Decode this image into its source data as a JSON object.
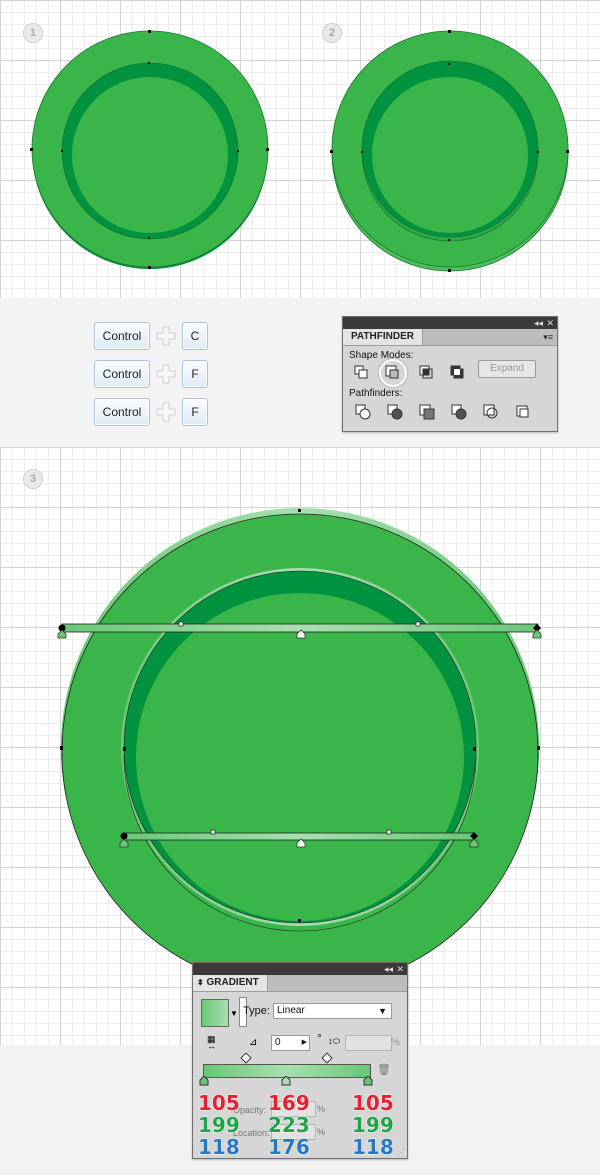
{
  "steps": [
    "1",
    "2",
    "3"
  ],
  "shortcuts": [
    {
      "modifier": "Control",
      "key": "C"
    },
    {
      "modifier": "Control",
      "key": "F"
    },
    {
      "modifier": "Control",
      "key": "F"
    }
  ],
  "pathfinder": {
    "title": "PATHFINDER",
    "shape_modes_label": "Shape Modes:",
    "pathfinders_label": "Pathfinders:",
    "expand_label": "Expand",
    "collapse_glyph": "◂◂",
    "close_glyph": "✕",
    "menu_glyph": "▾≡"
  },
  "gradient": {
    "title": "GRADIENT",
    "type_label": "Type:",
    "type_value": "Linear",
    "angle_value": "0",
    "degree_symbol": "°",
    "percent_symbol": "%",
    "opacity_label": "Opacity:",
    "location_label": "Location:",
    "collapse_glyph": "◂◂",
    "close_glyph": "✕",
    "stops": [
      {
        "r": "105",
        "g": "199",
        "b": "118"
      },
      {
        "r": "169",
        "g": "223",
        "b": "176"
      },
      {
        "r": "105",
        "g": "199",
        "b": "118"
      }
    ]
  },
  "colors": {
    "plate_green": "#39b54a",
    "rim_dark_green": "#009245",
    "gradient_light": "#a9dfb0",
    "gradient_dark": "#69c776"
  }
}
